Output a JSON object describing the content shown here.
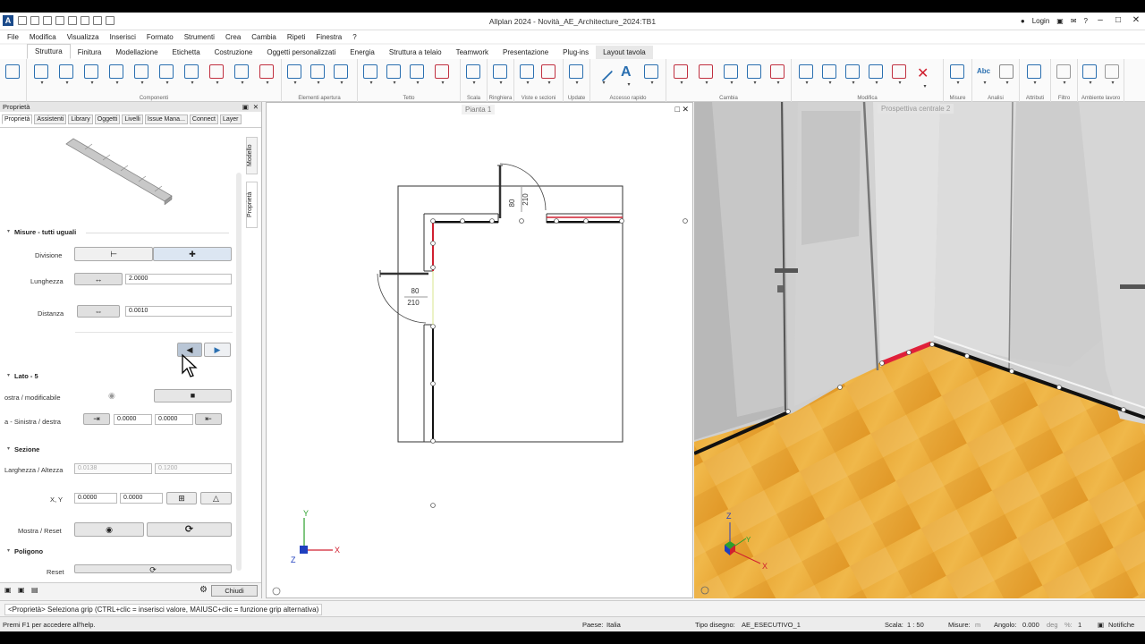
{
  "window": {
    "title": "Allplan 2024 - Novità_AE_Architecture_2024:TB1",
    "login": "Login"
  },
  "menu": [
    "File",
    "Modifica",
    "Visualizza",
    "Inserisci",
    "Formato",
    "Strumenti",
    "Crea",
    "Cambia",
    "Ripeti",
    "Finestra",
    "?"
  ],
  "ribbon_tabs": [
    "Struttura",
    "Finitura",
    "Modellazione",
    "Etichetta",
    "Costruzione",
    "Oggetti personalizzati",
    "Energia",
    "Struttura a telaio",
    "Teamwork",
    "Presentazione",
    "Plug-ins",
    "Layout tavola"
  ],
  "ribbon_groups": [
    "Componenti",
    "Elementi apertura",
    "Tetto",
    "Scala",
    "Ringhiera",
    "Viste e sezioni",
    "Update",
    "Accesso rapido",
    "Cambia",
    "Modifica",
    "Misure",
    "Analisi",
    "Attributi",
    "Filtro",
    "Ambiente lavoro"
  ],
  "ribbon_texts": {
    "text_tool": "A",
    "abc_tool": "Abc"
  },
  "panel": {
    "header": "Proprietà",
    "tabs": [
      "Proprietà",
      "Assistenti",
      "Library",
      "Oggetti",
      "Livelli",
      "Issue Mana...",
      "Connect",
      "Layer"
    ],
    "vtabs": [
      "Modello",
      "Proprietà"
    ],
    "sec_misure": "Misure - tutti uguali",
    "divisione_label": "Divisione",
    "lunghezza_label": "Lunghezza",
    "lunghezza_value": "2.0000",
    "distanza_label": "Distanza",
    "distanza_value": "0.0010",
    "sec_lato": "Lato",
    "lato_num": "5",
    "mostra_mod_label": "ostra / modificabile",
    "sin_des_label": "a - Sinistra / destra",
    "sin_value": "0.0000",
    "des_value": "0.0000",
    "sec_sezione": "Sezione",
    "larg_alt_label": "Larghezza / Altezza",
    "larg_value": "0.0138",
    "alt_value": "0.1200",
    "xy_label": "X, Y",
    "x_value": "0.0000",
    "y_value": "0.0000",
    "mostra_reset_label": "Mostra / Reset",
    "sec_poligono": "Poligono",
    "reset_label": "Reset",
    "close_label": "Chiudi"
  },
  "plan": {
    "title": "Pianta 1",
    "door_top_w": "80",
    "door_top_h": "210",
    "door_left_w": "80",
    "door_left_h": "210",
    "axis_x": "X",
    "axis_y": "Y",
    "axis_z": "Z"
  },
  "view3d": {
    "title": "Prospettiva centrale 2",
    "axis_x": "X",
    "axis_y": "Y",
    "axis_z": "Z"
  },
  "status": {
    "message": "<Proprietà> Seleziona grip (CTRL+clic = inserisci valore, MAIUSC+clic = funzione grip alternativa)",
    "help": "Premi F1 per accedere all'help.",
    "paese_label": "Paese:",
    "paese": "Italia",
    "tipo_label": "Tipo disegno:",
    "tipo": "AE_ESECUTIVO_1",
    "scala_label": "Scala:",
    "scala": "1 : 50",
    "misure_label": "Misure:",
    "misure": "m",
    "angolo_label": "Angolo:",
    "angolo": "0.000",
    "deg": "deg",
    "percent": "%:",
    "percent_value": "1",
    "notifiche": "Notifiche"
  },
  "colors": {
    "accent": "#2a6fb0",
    "highlight": "#e0203a",
    "floor": "#e9a83a"
  }
}
